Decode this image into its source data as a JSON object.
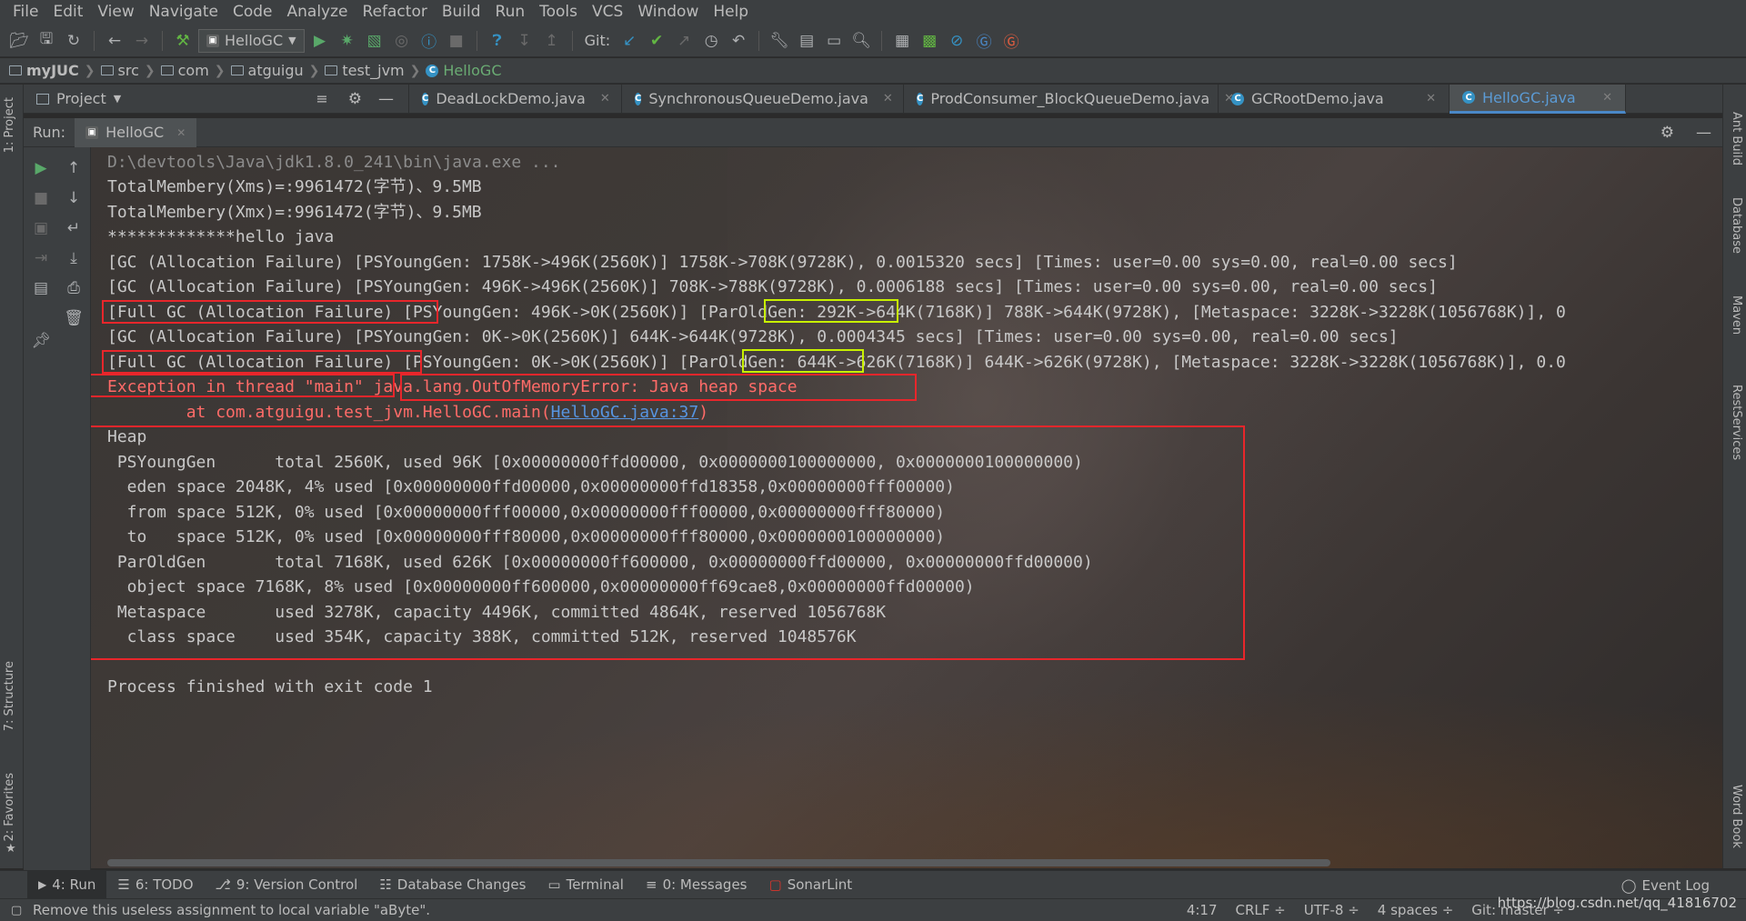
{
  "menu": [
    "File",
    "Edit",
    "View",
    "Navigate",
    "Code",
    "Analyze",
    "Refactor",
    "Build",
    "Run",
    "Tools",
    "VCS",
    "Window",
    "Help"
  ],
  "toolbar": {
    "run_config": "HelloGC",
    "git_label": "Git:"
  },
  "breadcrumbs": [
    "myJUC",
    "src",
    "com",
    "atguigu",
    "test_jvm",
    "HelloGC"
  ],
  "project_pane": {
    "title": "Project"
  },
  "editor_tabs": [
    {
      "label": "DeadLockDemo.java",
      "active": false
    },
    {
      "label": "SynchronousQueueDemo.java",
      "active": false
    },
    {
      "label": "ProdConsumer_BlockQueueDemo.java",
      "active": false
    },
    {
      "label": "GCRootDemo.java",
      "active": false
    },
    {
      "label": "HelloGC.java",
      "active": true
    }
  ],
  "left_tool_windows": [
    "1: Project",
    "7: Structure",
    "2: Favorites"
  ],
  "right_tool_windows": [
    "Ant Build",
    "Database",
    "Maven",
    "RestServices",
    "Word Book"
  ],
  "run_panel": {
    "label": "Run:",
    "tab": "HelloGC"
  },
  "console": {
    "lines": [
      "D:\\devtools\\Java\\jdk1.8.0_241\\bin\\java.exe ...",
      "TotalMembery(Xms)=:9961472(字节)、9.5MB",
      "TotalMembery(Xmx)=:9961472(字节)、9.5MB",
      "*************hello java",
      "[GC (Allocation Failure) [PSYoungGen: 1758K->496K(2560K)] 1758K->708K(9728K), 0.0015320 secs] [Times: user=0.00 sys=0.00, real=0.00 secs]",
      "[GC (Allocation Failure) [PSYoungGen: 496K->496K(2560K)] 708K->788K(9728K), 0.0006188 secs] [Times: user=0.00 sys=0.00, real=0.00 secs]",
      "[Full GC (Allocation Failure) [PSYoungGen: 496K->0K(2560K)] [ParOldGen: 292K->644K(7168K)] 788K->644K(9728K), [Metaspace: 3228K->3228K(1056768K)], 0",
      "[GC (Allocation Failure) [PSYoungGen: 0K->0K(2560K)] 644K->644K(9728K), 0.0004345 secs] [Times: user=0.00 sys=0.00, real=0.00 secs]",
      "[Full GC (Allocation Failure) [PSYoungGen: 0K->0K(2560K)] [ParOldGen: 644K->626K(7168K)] 644K->626K(9728K), [Metaspace: 3228K->3228K(1056768K)], 0.0",
      "Exception in thread \"main\" java.lang.OutOfMemoryError: Java heap space",
      "Heap",
      " PSYoungGen      total 2560K, used 96K [0x00000000ffd00000, 0x0000000100000000, 0x0000000100000000)",
      "  eden space 2048K, 4% used [0x00000000ffd00000,0x00000000ffd18358,0x00000000fff00000)",
      "  from space 512K, 0% used [0x00000000fff00000,0x00000000fff00000,0x00000000fff80000)",
      "  to   space 512K, 0% used [0x00000000fff80000,0x00000000fff80000,0x0000000100000000)",
      " ParOldGen       total 7168K, used 626K [0x00000000ff600000, 0x00000000ffd00000, 0x00000000ffd00000)",
      "  object space 7168K, 8% used [0x00000000ff600000,0x00000000ff69cae8,0x00000000ffd00000)",
      " Metaspace       used 3278K, capacity 4496K, committed 4864K, reserved 1056768K",
      "  class space    used 354K, capacity 388K, committed 512K, reserved 1048576K",
      "Process finished with exit code 1"
    ],
    "trace_prefix": "\tat com.atguigu.test_jvm.HelloGC.main(",
    "trace_link": "HelloGC.java:37",
    "trace_suffix": ")"
  },
  "bottom_tabs": [
    {
      "label": "4: Run",
      "active": true
    },
    {
      "label": "6: TODO",
      "active": false
    },
    {
      "label": "9: Version Control",
      "active": false
    },
    {
      "label": "Database Changes",
      "active": false
    },
    {
      "label": "Terminal",
      "active": false
    },
    {
      "label": "0: Messages",
      "active": false
    },
    {
      "label": "SonarLint",
      "active": false
    }
  ],
  "event_log": "Event Log",
  "status": {
    "message": "Remove this useless assignment to local variable \"aByte\".",
    "caret": "4:17",
    "line_sep": "CRLF ÷",
    "encoding": "UTF-8 ÷",
    "indent": "4 spaces ÷",
    "git_branch": "Git: master ÷"
  },
  "watermark": "https://blog.csdn.net/qq_41816702",
  "colors": {
    "error": "#ff6b68",
    "highlight_red": "#e8262b",
    "highlight_yellow": "#c8f000",
    "link": "#5794e0",
    "active_tab": "#5b9bd5"
  }
}
